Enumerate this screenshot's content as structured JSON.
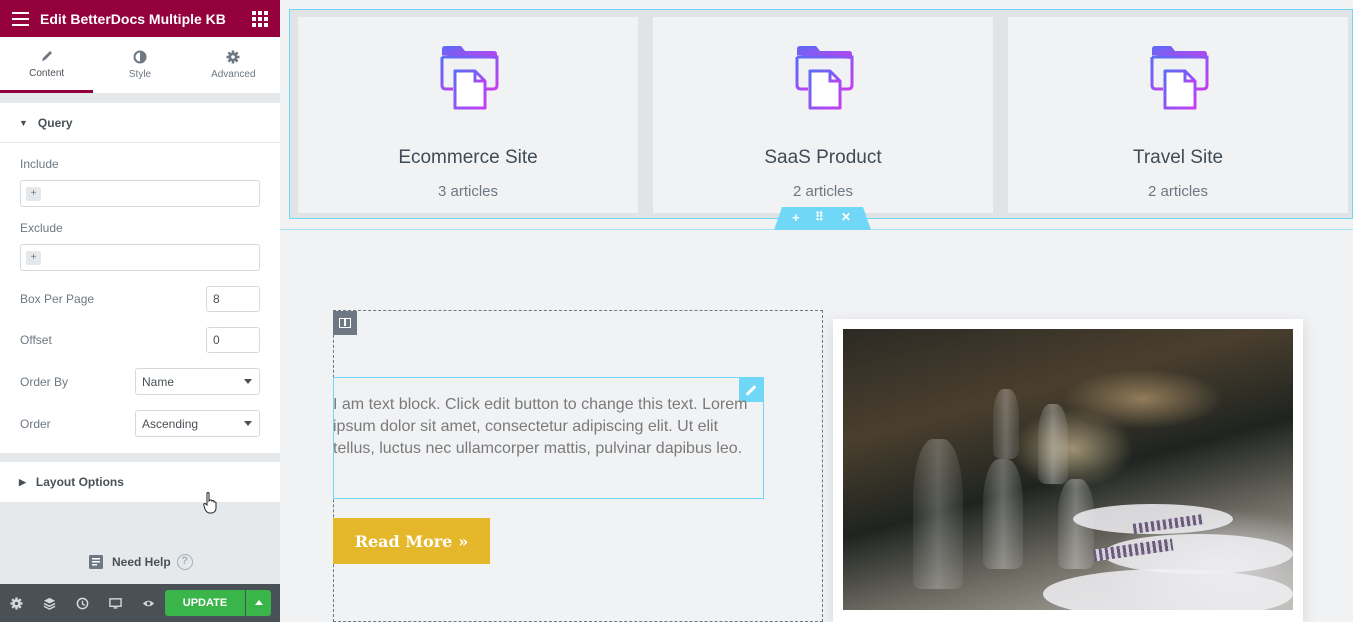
{
  "header": {
    "title": "Edit BetterDocs Multiple KB"
  },
  "tabs": [
    {
      "label": "Content",
      "icon": "pencil-icon",
      "active": true
    },
    {
      "label": "Style",
      "icon": "half-circle-icon",
      "active": false
    },
    {
      "label": "Advanced",
      "icon": "gear-icon",
      "active": false
    }
  ],
  "query": {
    "title": "Query",
    "include_label": "Include",
    "exclude_label": "Exclude",
    "add_symbol": "+",
    "box_per_page_label": "Box Per Page",
    "box_per_page_value": "8",
    "offset_label": "Offset",
    "offset_value": "0",
    "order_by_label": "Order By",
    "order_by_value": "Name",
    "order_label": "Order",
    "order_value": "Ascending"
  },
  "layout_options": {
    "title": "Layout Options"
  },
  "help": {
    "label": "Need Help",
    "symbol": "?"
  },
  "footer": {
    "icons": [
      "settings-icon",
      "layers-icon",
      "history-icon",
      "responsive-icon",
      "preview-icon"
    ],
    "update_label": "UPDATE"
  },
  "kb_cards": [
    {
      "title": "Ecommerce Site",
      "count": "3 articles"
    },
    {
      "title": "SaaS Product",
      "count": "2 articles"
    },
    {
      "title": "Travel Site",
      "count": "2 articles"
    }
  ],
  "section_handle": {
    "add": "+",
    "move": "⠿",
    "close": "✕"
  },
  "text_block": "I am text block. Click edit button to change this text. Lorem ipsum dolor sit amet, consectetur adipiscing elit. Ut elit tellus, luctus nec ullamcorper mattis, pulvinar dapibus leo.",
  "read_more": {
    "label": "Read More",
    "arrow": "»"
  },
  "colors": {
    "brand": "#93003c",
    "update": "#39b54a",
    "selection": "#71d7f7",
    "button": "#e5b82c",
    "icon_gradient_start": "#5b6cf5",
    "icon_gradient_end": "#c53ef0"
  }
}
